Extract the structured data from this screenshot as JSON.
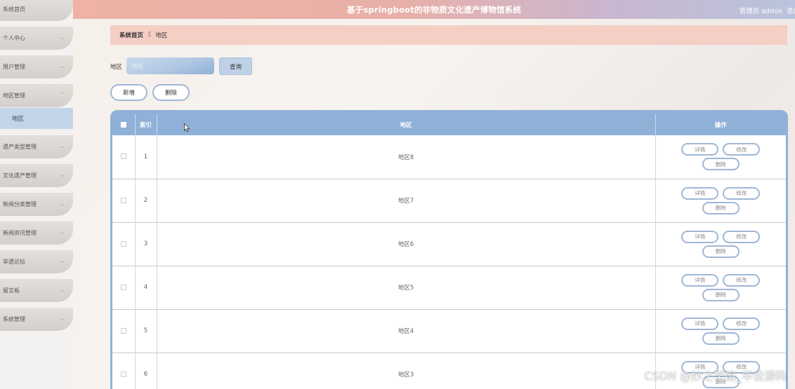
{
  "header": {
    "title": "基于springboot的非物质文化遗产博物馆系统",
    "user": "管理员 admin",
    "logout": "退出"
  },
  "sidebar": {
    "items": [
      {
        "label": "系统首页"
      },
      {
        "label": "个人中心"
      },
      {
        "label": "用户管理"
      },
      {
        "label": "地区管理"
      },
      {
        "label": "遗产类型管理"
      },
      {
        "label": "文化遗产管理"
      },
      {
        "label": "新闻分类管理"
      },
      {
        "label": "新闻资讯管理"
      },
      {
        "label": "非遗论坛"
      },
      {
        "label": "留言板"
      },
      {
        "label": "系统管理"
      }
    ],
    "active_sub": "地区"
  },
  "breadcrumb": {
    "home": "系统首页",
    "separator": "Ξ",
    "current": "地区"
  },
  "search": {
    "label": "地区",
    "placeholder": "地区",
    "button": "查询"
  },
  "actions": {
    "add": "新增",
    "delete": "删除"
  },
  "table": {
    "headers": {
      "index": "索引",
      "region": "地区",
      "ops": "操作"
    },
    "rows": [
      {
        "index": "1",
        "region": "地区8"
      },
      {
        "index": "2",
        "region": "地区7"
      },
      {
        "index": "3",
        "region": "地区6"
      },
      {
        "index": "4",
        "region": "地区5"
      },
      {
        "index": "5",
        "region": "地区4"
      },
      {
        "index": "6",
        "region": "地区3"
      }
    ],
    "row_buttons": {
      "detail": "详情",
      "edit": "修改",
      "delete": "删除"
    }
  },
  "watermark": "CSDN @妙之学姐_毕设源码",
  "colors": {
    "accent": "#8fb1d8",
    "breadcrumb_bg": "#f5cec6",
    "header_start": "#eeb3a6",
    "header_end": "#b9c4dc"
  }
}
